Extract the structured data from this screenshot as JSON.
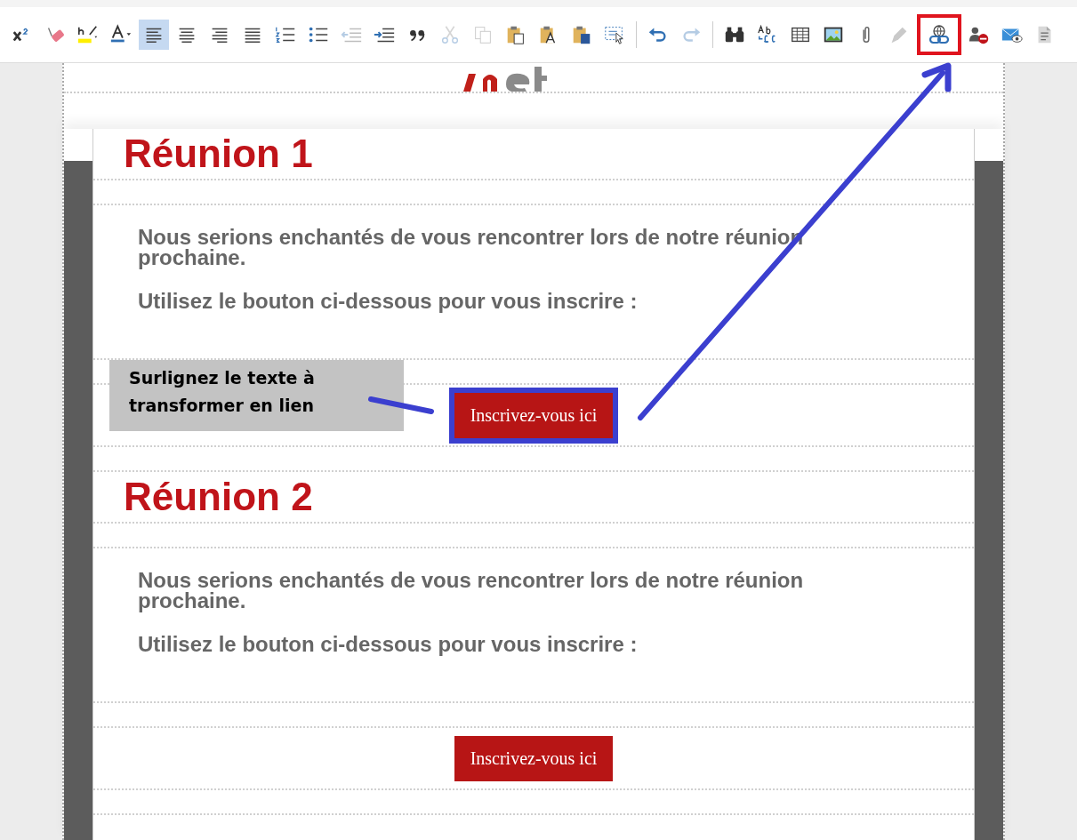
{
  "toolbar": {
    "groups": [
      {
        "tools": [
          {
            "kind": "superscript",
            "selected": false,
            "disabled": false,
            "marked": false
          },
          {
            "kind": "eraser",
            "selected": false,
            "disabled": false,
            "marked": false
          },
          {
            "kind": "highlight",
            "selected": false,
            "disabled": false,
            "marked": false
          },
          {
            "kind": "font-color",
            "selected": false,
            "disabled": false,
            "marked": false
          },
          {
            "kind": "align-left",
            "selected": true,
            "disabled": false,
            "marked": false
          },
          {
            "kind": "align-center",
            "selected": false,
            "disabled": false,
            "marked": false
          },
          {
            "kind": "align-right",
            "selected": false,
            "disabled": false,
            "marked": false
          },
          {
            "kind": "justify",
            "selected": false,
            "disabled": false,
            "marked": false
          },
          {
            "kind": "numbered-list",
            "selected": false,
            "disabled": false,
            "marked": false
          },
          {
            "kind": "bullet-list",
            "selected": false,
            "disabled": false,
            "marked": false
          },
          {
            "kind": "outdent",
            "selected": false,
            "disabled": true,
            "marked": false
          },
          {
            "kind": "indent",
            "selected": false,
            "disabled": false,
            "marked": false
          },
          {
            "kind": "quote",
            "selected": false,
            "disabled": false,
            "marked": false
          },
          {
            "kind": "cut",
            "selected": false,
            "disabled": true,
            "marked": false
          },
          {
            "kind": "copy",
            "selected": false,
            "disabled": true,
            "marked": false
          },
          {
            "kind": "paste",
            "selected": false,
            "disabled": false,
            "marked": false
          },
          {
            "kind": "paste-text",
            "selected": false,
            "disabled": false,
            "marked": false
          },
          {
            "kind": "paste-word",
            "selected": false,
            "disabled": false,
            "marked": false
          },
          {
            "kind": "select-all",
            "selected": false,
            "disabled": false,
            "marked": false
          }
        ]
      },
      {
        "tools": [
          {
            "kind": "undo",
            "selected": false,
            "disabled": false,
            "marked": false
          },
          {
            "kind": "redo",
            "selected": false,
            "disabled": true,
            "marked": false
          }
        ]
      },
      {
        "tools": [
          {
            "kind": "find",
            "selected": false,
            "disabled": false,
            "marked": false
          },
          {
            "kind": "replace",
            "selected": false,
            "disabled": false,
            "marked": false
          },
          {
            "kind": "table",
            "selected": false,
            "disabled": false,
            "marked": false
          },
          {
            "kind": "image",
            "selected": false,
            "disabled": false,
            "marked": false
          },
          {
            "kind": "attachment",
            "selected": false,
            "disabled": false,
            "marked": false
          },
          {
            "kind": "pen",
            "selected": false,
            "disabled": true,
            "marked": false
          },
          {
            "kind": "link",
            "selected": false,
            "disabled": false,
            "marked": true
          },
          {
            "kind": "remove-user",
            "selected": false,
            "disabled": false,
            "marked": false
          },
          {
            "kind": "email-preview",
            "selected": false,
            "disabled": false,
            "marked": false
          },
          {
            "kind": "document",
            "selected": false,
            "disabled": false,
            "marked": false
          }
        ]
      }
    ]
  },
  "sections": [
    {
      "heading": "Réunion 1",
      "paragraphs": [
        "Nous serions enchantés de vous rencontrer lors de notre réunion prochaine.",
        "Utilisez le bouton ci-dessous pour vous inscrire :"
      ],
      "button": {
        "label": "Inscrivez-vous ici",
        "framed": true
      }
    },
    {
      "heading": "Réunion 2",
      "paragraphs": [
        "Nous serions enchantés de vous rencontrer lors de notre réunion prochaine.",
        "Utilisez le bouton ci-dessous pour vous inscrire :"
      ],
      "button": {
        "label": "Inscrivez-vous ici",
        "framed": false
      }
    }
  ],
  "callout": {
    "text": "Surlignez le texte à\ntransformer en lien"
  }
}
